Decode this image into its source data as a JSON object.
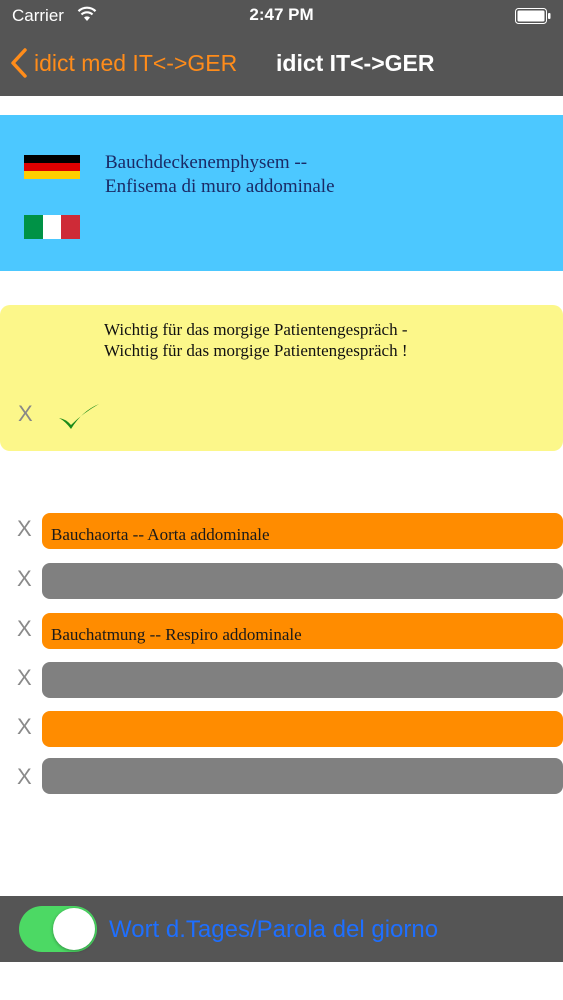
{
  "status_bar": {
    "carrier": "Carrier",
    "time": "2:47 PM",
    "wifi_icon": "wifi-icon",
    "battery_icon": "battery-icon"
  },
  "nav": {
    "back_label": "idict med IT<->GER",
    "title": "idict IT<->GER",
    "back_icon": "chevron-left-icon",
    "accent_color": "#ff8c1a"
  },
  "entry": {
    "german": "Bauchdeckenemphysem  --",
    "italian": "Enfisema di muro addominale",
    "flag_de_icon": "flag-germany-icon",
    "flag_it_icon": "flag-italy-icon",
    "background": "#4cc8ff"
  },
  "note": {
    "text": "Wichtig für das morgige Patientengespräch - Wichtig für das morgige Patientengespräch !",
    "delete_label": "X",
    "confirm_icon": "checkmark-icon",
    "background": "#fcf78a"
  },
  "rows": [
    {
      "delete_label": "X",
      "text": "Bauchaorta  -- Aorta addominale",
      "color": "#ff8c00"
    },
    {
      "delete_label": "X",
      "text": "",
      "color": "#808080"
    },
    {
      "delete_label": "X",
      "text": "Bauchatmung  -- Respiro addominale",
      "color": "#ff8c00"
    },
    {
      "delete_label": "X",
      "text": "",
      "color": "#808080"
    },
    {
      "delete_label": "X",
      "text": "",
      "color": "#ff8c00"
    },
    {
      "delete_label": "X",
      "text": "",
      "color": "#808080"
    }
  ],
  "bottom": {
    "toggle_on": true,
    "label": "Wort d.Tages/Parola del giorno"
  }
}
